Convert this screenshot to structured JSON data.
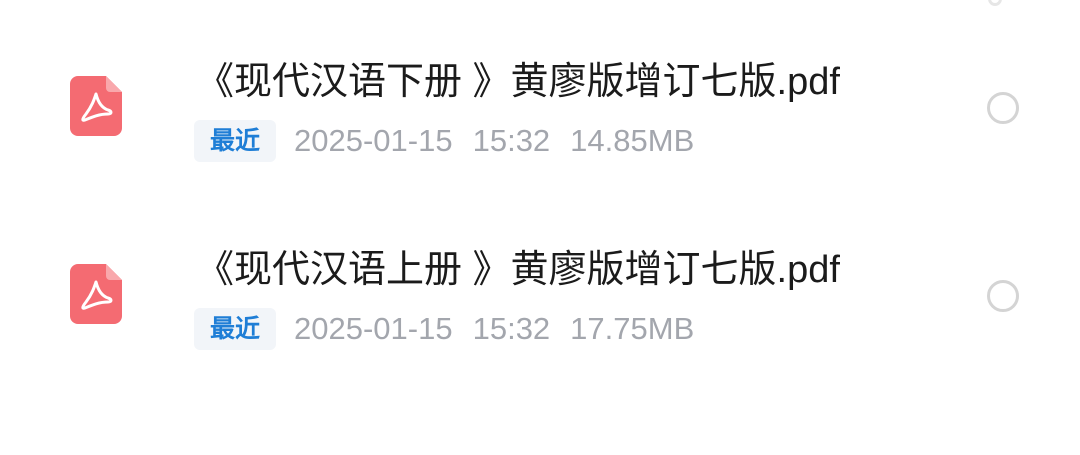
{
  "files": [
    {
      "name": "《现代汉语下册 》黄廖版增订七版.pdf",
      "badge": "最近",
      "date": "2025-01-15",
      "time": "15:32",
      "size": "14.85MB",
      "selected": false
    },
    {
      "name": "《现代汉语上册 》黄廖版增订七版.pdf",
      "badge": "最近",
      "date": "2025-01-15",
      "time": "15:32",
      "size": "17.75MB",
      "selected": false
    }
  ],
  "colors": {
    "pdf_icon": "#f46b72",
    "badge_text": "#1f7ed6",
    "badge_bg": "#f2f5f9",
    "meta_text": "#a3a6ad",
    "title_text": "#1b1b1b"
  },
  "icons": {
    "file_type": "pdf-acrobat-icon",
    "select": "radio-circle-icon"
  }
}
